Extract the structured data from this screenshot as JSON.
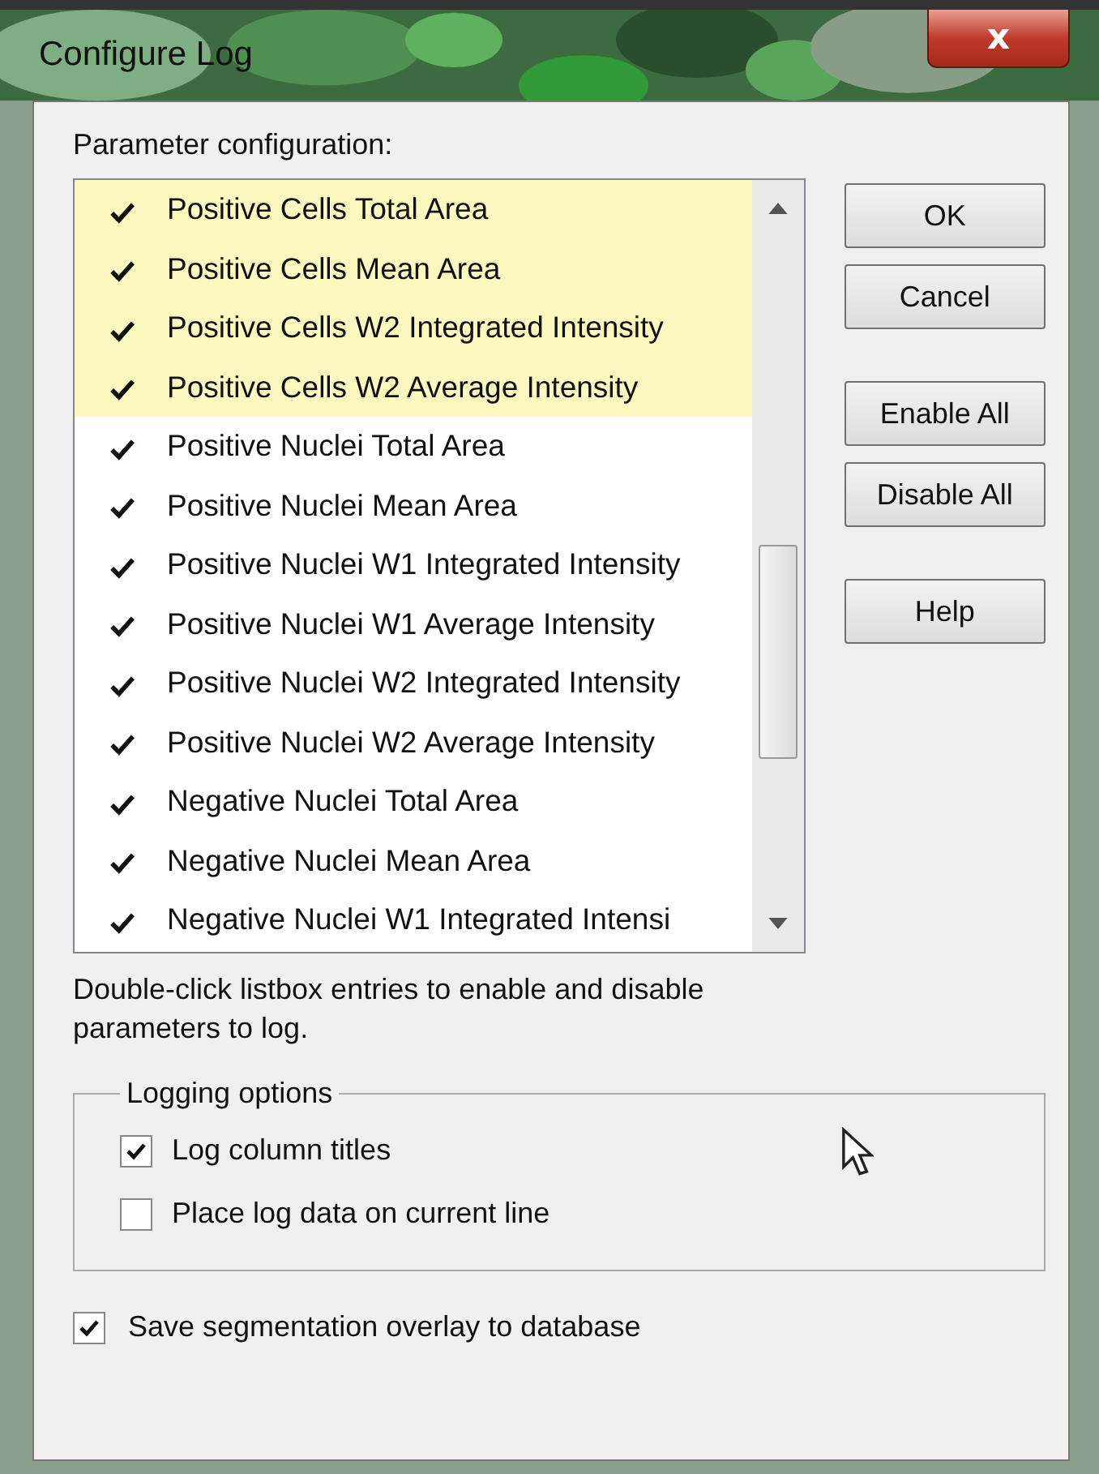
{
  "window": {
    "title": "Configure Log",
    "close": "x"
  },
  "parameter_list": {
    "label": "Parameter configuration:",
    "items": [
      {
        "text": "Positive Cells Total Area",
        "enabled": true,
        "selected": true
      },
      {
        "text": "Positive Cells Mean Area",
        "enabled": true,
        "selected": true
      },
      {
        "text": "Positive Cells W2 Integrated Intensity",
        "enabled": true,
        "selected": true
      },
      {
        "text": "Positive Cells W2 Average Intensity",
        "enabled": true,
        "selected": true
      },
      {
        "text": "Positive Nuclei Total Area",
        "enabled": true,
        "selected": false
      },
      {
        "text": "Positive Nuclei Mean Area",
        "enabled": true,
        "selected": false
      },
      {
        "text": "Positive Nuclei W1 Integrated Intensity",
        "enabled": true,
        "selected": false
      },
      {
        "text": "Positive Nuclei W1 Average Intensity",
        "enabled": true,
        "selected": false
      },
      {
        "text": "Positive Nuclei W2 Integrated Intensity",
        "enabled": true,
        "selected": false
      },
      {
        "text": "Positive Nuclei W2 Average Intensity",
        "enabled": true,
        "selected": false
      },
      {
        "text": "Negative Nuclei Total Area",
        "enabled": true,
        "selected": false
      },
      {
        "text": "Negative Nuclei Mean Area",
        "enabled": true,
        "selected": false
      },
      {
        "text": "Negative Nuclei W1 Integrated Intensi",
        "enabled": true,
        "selected": false
      }
    ],
    "hint": "Double-click listbox entries to enable and disable parameters to log."
  },
  "buttons": [
    {
      "label": "OK"
    },
    {
      "label": "Cancel"
    },
    {
      "label": "Enable All"
    },
    {
      "label": "Disable All"
    },
    {
      "label": "Help"
    }
  ],
  "logging_options": {
    "title": "Logging options",
    "options": [
      {
        "label": "Log column titles",
        "checked": true
      },
      {
        "label": "Place log data on current line",
        "checked": false
      }
    ]
  },
  "save_overlay": {
    "label": "Save segmentation overlay to database",
    "checked": true
  }
}
